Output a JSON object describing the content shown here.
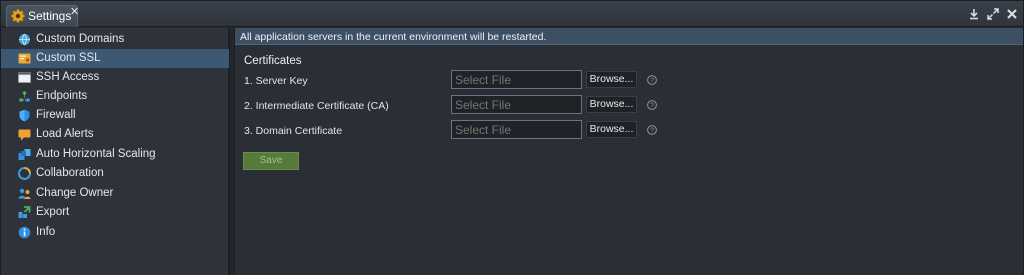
{
  "window": {
    "tab_title": "Settings",
    "tab_icon": "gear-icon",
    "controls": [
      "download-icon",
      "expand-icon",
      "close-icon"
    ]
  },
  "sidebar": {
    "items": [
      {
        "label": "Custom Domains",
        "icon": "custom-domains-icon"
      },
      {
        "label": "Custom SSL",
        "icon": "custom-ssl-icon",
        "active": true
      },
      {
        "label": "SSH Access",
        "icon": "ssh-terminal-icon"
      },
      {
        "label": "Endpoints",
        "icon": "endpoints-icon"
      },
      {
        "label": "Firewall",
        "icon": "shield-icon"
      },
      {
        "label": "Load Alerts",
        "icon": "load-alerts-icon"
      },
      {
        "label": "Auto Horizontal Scaling",
        "icon": "scaling-icon"
      },
      {
        "label": "Collaboration",
        "icon": "collaboration-icon"
      },
      {
        "label": "Change Owner",
        "icon": "change-owner-icon"
      },
      {
        "label": "Export",
        "icon": "export-icon"
      },
      {
        "label": "Info",
        "icon": "info-icon"
      }
    ]
  },
  "main": {
    "notice": "All application servers in the current environment will be restarted.",
    "section_title": "Certificates",
    "fields": [
      {
        "label": "1. Server Key",
        "placeholder": "Select File",
        "browse_label": "Browse..."
      },
      {
        "label": "2. Intermediate Certificate (CA)",
        "placeholder": "Select File",
        "browse_label": "Browse..."
      },
      {
        "label": "3. Domain Certificate",
        "placeholder": "Select File",
        "browse_label": "Browse..."
      }
    ],
    "save_label": "Save"
  },
  "colors": {
    "active_item": "#3c5872",
    "notice_bar": "#3d4f63",
    "save_button": "#567a3a"
  }
}
